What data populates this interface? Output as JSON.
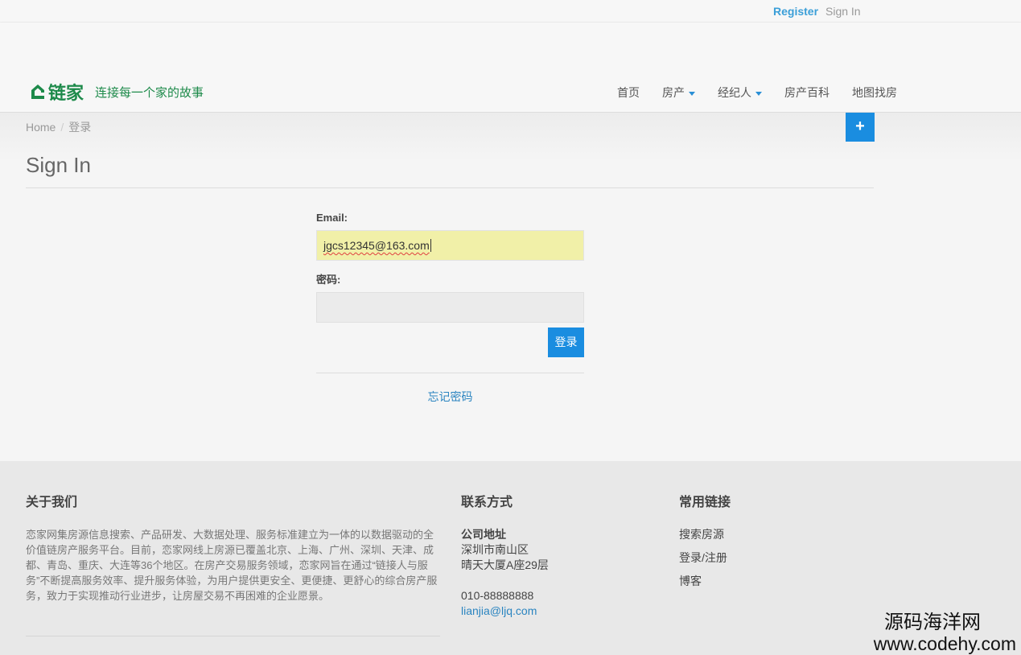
{
  "topbar": {
    "register": "Register",
    "signin": "Sign In"
  },
  "header": {
    "brand": "链家",
    "slogan": "连接每一个家的故事",
    "nav": [
      {
        "label": "首页",
        "dropdown": false
      },
      {
        "label": "房产",
        "dropdown": true
      },
      {
        "label": "经纪人",
        "dropdown": true
      },
      {
        "label": "房产百科",
        "dropdown": false
      },
      {
        "label": "地图找房",
        "dropdown": false
      }
    ]
  },
  "breadcrumb": {
    "home": "Home",
    "sep": "/",
    "current": "登录"
  },
  "plus_button": "+",
  "page_title": "Sign In",
  "form": {
    "email_label": "Email:",
    "email_value": "jgcs12345@163.com",
    "password_label": "密码:",
    "submit": "登录",
    "forgot": "忘记密码"
  },
  "footer": {
    "about_title": "关于我们",
    "about_text": "恋家网集房源信息搜索、产品研发、大数据处理、服务标准建立为一体的以数据驱动的全价值链房产服务平台。目前，恋家网线上房源已覆盖北京、上海、广州、深圳、天津、成都、青岛、重庆、大连等36个地区。在房产交易服务领域，恋家网旨在通过“链接人与服务”不断提高服务效率、提升服务体验，为用户提供更安全、更便捷、更舒心的综合房产服务，致力于实现推动行业进步，让房屋交易不再困难的企业愿景。",
    "contact_title": "联系方式",
    "address_title": "公司地址",
    "address_line1": "深圳市南山区",
    "address_line2": "晴天大厦A座29层",
    "phone": "010-88888888",
    "email": "lianjia@ljq.com",
    "links_title": "常用链接",
    "links": [
      "搜索房源",
      "登录/注册",
      "博客"
    ]
  },
  "watermark": {
    "cn": "源码海洋网",
    "en": "www.codehy.com"
  },
  "colors": {
    "accent": "#1a8de0",
    "brand_green": "#1d8a4a",
    "autofill": "#f1f0a8"
  }
}
